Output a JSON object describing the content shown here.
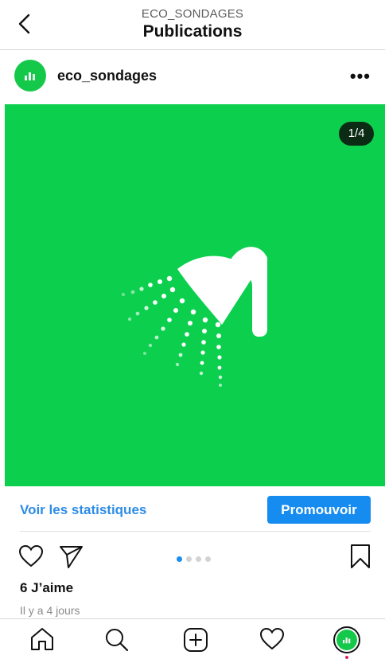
{
  "header": {
    "subtitle": "ECO_SONDAGES",
    "title": "Publications"
  },
  "post": {
    "username": "eco_sondages",
    "more_label": "•••",
    "image_counter": "1/4",
    "image_icon": "shower-head-icon",
    "stats_link": "Voir les statistiques",
    "promote_label": "Promouvoir",
    "carousel": {
      "current": 1,
      "total": 4
    },
    "likes": "6 J’aime",
    "time_ago": "Il y a 4 jours"
  },
  "tabbar": {
    "items": [
      "home-icon",
      "search-icon",
      "new-post-icon",
      "activity-heart-icon",
      "profile-avatar"
    ]
  },
  "colors": {
    "brand_green": "#0ccf4e",
    "link_blue": "#2e8ce6",
    "button_blue": "#168cf0",
    "counter_bg": "#0b2b14"
  }
}
